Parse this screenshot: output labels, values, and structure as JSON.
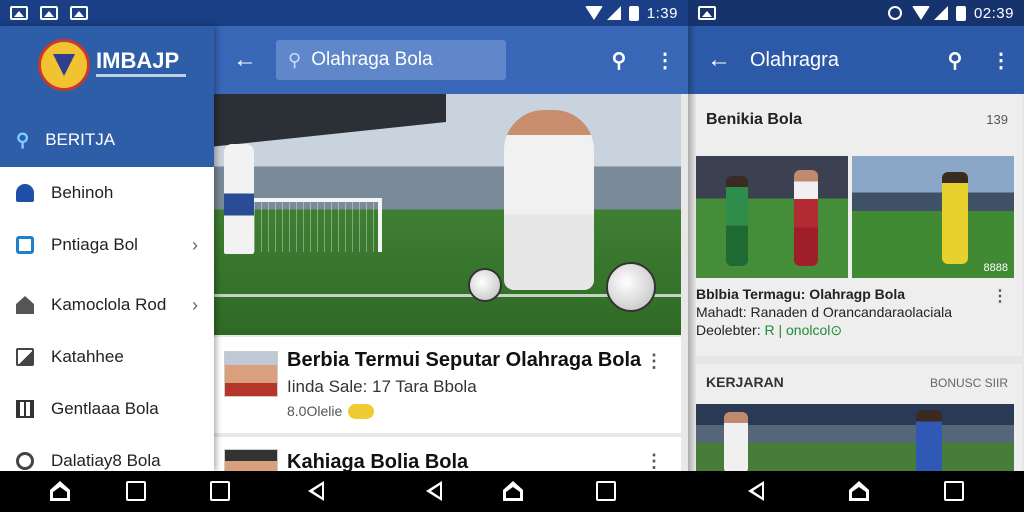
{
  "status_left": {
    "icons": [
      "image-icon",
      "photo-icon",
      "bookmark-icon"
    ],
    "time": "1:39"
  },
  "status_right": {
    "icons": [
      "alarm-icon",
      "wifi-icon",
      "signal-icon",
      "battery-icon"
    ],
    "time": "02:39"
  },
  "drawer": {
    "brand": "IMBAJP",
    "active_item": {
      "label": "BERITJA",
      "icon": "search-icon"
    },
    "items": [
      {
        "label": "Behinoh",
        "icon": "bell-icon",
        "has_chevron": false
      },
      {
        "label": "Pntiaga Bol",
        "icon": "box-icon",
        "has_chevron": true
      },
      {
        "label": "Kamoclola Rod",
        "icon": "home-icon",
        "has_chevron": true
      },
      {
        "label": "Katahhee",
        "icon": "image-icon",
        "has_chevron": false
      },
      {
        "label": "Gentlaaa Bola",
        "icon": "grid-icon",
        "has_chevron": false
      },
      {
        "label": "Dalatiay8 Bola",
        "icon": "circle-icon",
        "has_chevron": false
      }
    ],
    "chevron": "›"
  },
  "main": {
    "back": "←",
    "search_text": "Olahraga Bola",
    "search_glyph": "⚲",
    "more_glyph": "⋮",
    "cards": [
      {
        "title": "Berbia Termui Seputar Olahraga Bola",
        "subtitle": "Iinda Sale:  17 Tara Bbola",
        "meta": "8.0Olelie"
      },
      {
        "title": "Kahiaga Bolia Bola"
      }
    ]
  },
  "right": {
    "back": "←",
    "title": "Olahragra",
    "section1": {
      "heading": "Benikia Bola",
      "count": "139",
      "image_number": "8888",
      "caption_line1": "Bblbia Termagu: Olahragp Bola",
      "caption_line2": "Mahadt: Ranaden d Orancandaraolaciala",
      "caption_line3_prefix": "Deolebter: ",
      "caption_line3_green": "R | onolcol⊙"
    },
    "section2": {
      "heading": "KERJARAN",
      "link": "BONUSC SIIR"
    }
  },
  "colors": {
    "appbar": "#3867b8",
    "drawer_header": "#2f5ea9",
    "statusbar": "#1a3f86",
    "accent_green": "#1f8a35"
  }
}
